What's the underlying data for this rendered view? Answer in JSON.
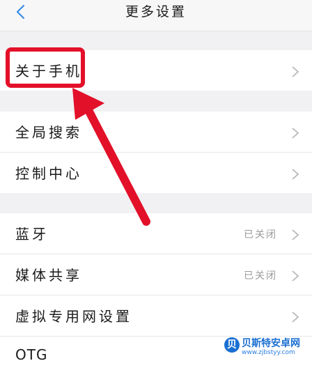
{
  "header": {
    "title": "更多设置",
    "back_icon": "chevron-left-icon"
  },
  "sections": [
    {
      "items": [
        {
          "label": "关于手机",
          "value": ""
        }
      ]
    },
    {
      "items": [
        {
          "label": "全局搜索",
          "value": ""
        },
        {
          "label": "控制中心",
          "value": ""
        }
      ]
    },
    {
      "items": [
        {
          "label": "蓝牙",
          "value": "已关闭"
        },
        {
          "label": "媒体共享",
          "value": "已关闭"
        },
        {
          "label": "虚拟专用网设置",
          "value": ""
        },
        {
          "label": "OTG",
          "value": ""
        }
      ]
    }
  ],
  "annotation": {
    "highlight_color": "#e3102a"
  },
  "watermark": {
    "name": "贝斯特安卓网",
    "url": "www.zjbstyy.com"
  },
  "colors": {
    "accent": "#3a8ee6",
    "background": "#f1f1f3"
  }
}
